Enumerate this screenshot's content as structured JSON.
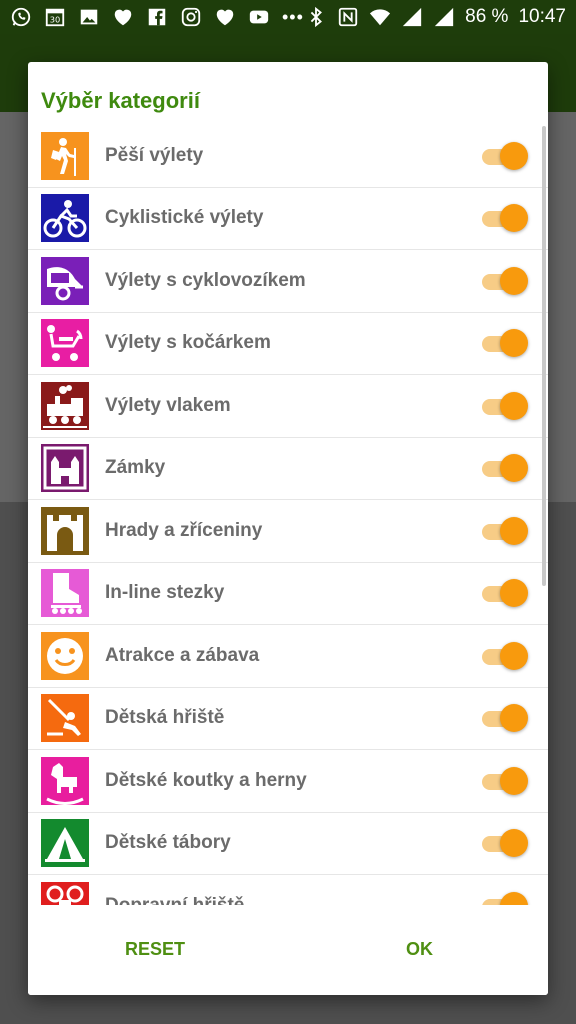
{
  "status_bar": {
    "battery_percent": "86 %",
    "time": "10:47",
    "left_icons": [
      "whatsapp-icon",
      "calendar-30-icon",
      "image-icon",
      "heart-icon",
      "facebook-icon",
      "instagram-icon",
      "heart-icon",
      "youtube-icon",
      "more-dots-icon"
    ],
    "right_icons": [
      "bluetooth-icon",
      "nfc-icon",
      "wifi-icon",
      "signal-icon",
      "signal-icon"
    ]
  },
  "dialog": {
    "title": "Výběr kategorií",
    "reset_label": "RESET",
    "ok_label": "OK",
    "categories": [
      {
        "label": "Pěší výlety",
        "icon": "hiker-icon",
        "color": "#f7931e",
        "enabled": true
      },
      {
        "label": "Cyklistické výlety",
        "icon": "cyclist-icon",
        "color": "#1a1aa8",
        "enabled": true
      },
      {
        "label": "Výlety s cyklovozíkem",
        "icon": "bike-trailer-icon",
        "color": "#7a1fb8",
        "enabled": true
      },
      {
        "label": "Výlety s kočárkem",
        "icon": "stroller-icon",
        "color": "#e81ea3",
        "enabled": true
      },
      {
        "label": "Výlety vlakem",
        "icon": "steam-train-icon",
        "color": "#8a1a1a",
        "enabled": true
      },
      {
        "label": "Zámky",
        "icon": "chateau-icon",
        "color": "#7a1a6e",
        "enabled": true
      },
      {
        "label": "Hrady a zříceniny",
        "icon": "castle-icon",
        "color": "#7a5a12",
        "enabled": true
      },
      {
        "label": "In-line stezky",
        "icon": "inline-skate-icon",
        "color": "#e65ad6",
        "enabled": true
      },
      {
        "label": "Atrakce a zábava",
        "icon": "smiley-icon",
        "color": "#f7931e",
        "enabled": true
      },
      {
        "label": "Dětská hřiště",
        "icon": "swing-icon",
        "color": "#f56a0f",
        "enabled": true
      },
      {
        "label": "Dětské koutky a herny",
        "icon": "rocking-horse-icon",
        "color": "#e81e9e",
        "enabled": true
      },
      {
        "label": "Dětské tábory",
        "icon": "tent-icon",
        "color": "#138a2e",
        "enabled": true
      },
      {
        "label": "Dopravní hřiště",
        "icon": "traffic-playground-icon",
        "color": "#e01e1e",
        "enabled": true
      }
    ]
  },
  "colors": {
    "accent_green": "#3f8a0f",
    "toggle_on": "#f89a0d"
  }
}
